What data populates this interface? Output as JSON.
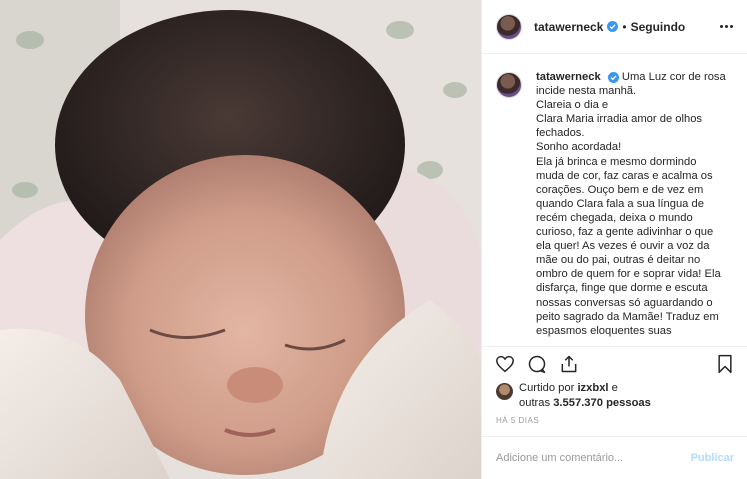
{
  "post": {
    "username": "tatawerneck",
    "follow_status": "Seguindo",
    "separator": "•",
    "caption_lines": [
      "Uma Luz cor de rosa",
      "incide nesta manhã.",
      "Clareia o dia e",
      "Clara Maria irradia amor de olhos",
      "fechados.",
      "Sonho acordada!",
      "Ela já brinca e mesmo dormindo",
      "muda de cor, faz caras e acalma os",
      "corações. Ouço bem e de vez em",
      "quando Clara fala a sua língua de",
      "recém chegada, deixa o mundo",
      "curioso, faz a gente adivinhar o que",
      "ela quer! As vezes é ouvir a voz da",
      "mãe ou do pai, outras é deitar no",
      "ombro de quem for e soprar vida! Ela",
      "disfarça, finge que dorme e escuta",
      "nossas conversas só aguardando o",
      "peito sagrado da Mamãe! Traduz em",
      "espasmos eloquentes suas"
    ],
    "liked_by_prefix": "Curtido por",
    "liked_by_user": "izxbxl",
    "liked_by_and": "e",
    "others_prefix": "outras",
    "others_count": "3.557.370",
    "others_suffix": "pessoas",
    "timestamp": "HÁ 5 DIAS",
    "comment_placeholder": "Adicione um comentário...",
    "publish_label": "Publicar",
    "icons": {
      "more": "more-options-icon",
      "verified": "verified-badge-icon",
      "like": "heart-icon",
      "comment": "comment-icon",
      "share": "share-icon",
      "save": "bookmark-icon"
    },
    "colors": {
      "verified": "#3897f0",
      "publish_disabled": "#b3dbff",
      "muted": "#999999"
    }
  }
}
